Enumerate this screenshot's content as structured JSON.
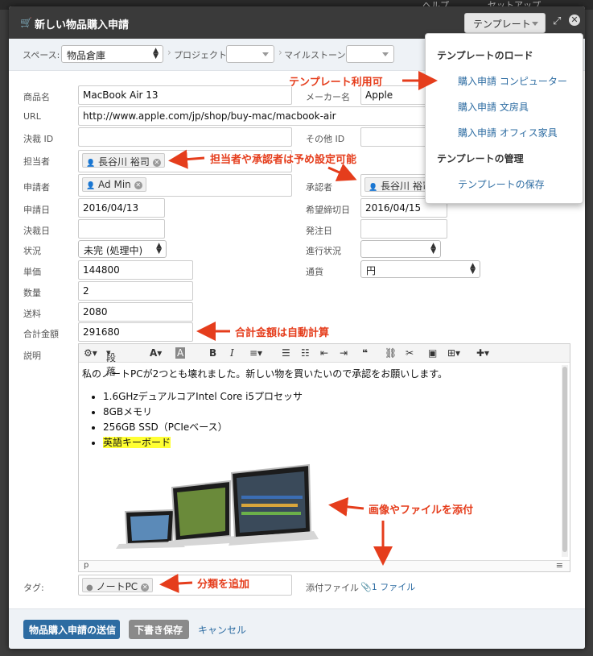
{
  "background": {
    "left_text": "ヘルプ",
    "right_text": "セットアップ"
  },
  "titlebar": {
    "title": "新しい物品購入申請",
    "template_button": "テンプレート"
  },
  "toolbar": {
    "space_label": "スペース:",
    "space_value": "物品倉庫",
    "project_label": "プロジェクト",
    "milestone_label": "マイルストーン"
  },
  "form": {
    "product_name": {
      "label": "商品名",
      "value": "MacBook Air 13"
    },
    "maker": {
      "label": "メーカー名",
      "value": "Apple"
    },
    "url": {
      "label": "URL",
      "value": "http://www.apple.com/jp/shop/buy-mac/macbook-air"
    },
    "decision_id": {
      "label": "決裁 ID",
      "value": ""
    },
    "other_id": {
      "label": "その他 ID",
      "value": ""
    },
    "assignee": {
      "label": "担当者",
      "value": "長谷川 裕司"
    },
    "applicant": {
      "label": "申請者",
      "value": "Ad Min"
    },
    "approver": {
      "label": "承認者",
      "value": "長谷川 裕司"
    },
    "apply_date": {
      "label": "申請日",
      "value": "2016/04/13"
    },
    "due_date": {
      "label": "希望締切日",
      "value": "2016/04/15"
    },
    "decision_date": {
      "label": "決裁日",
      "value": ""
    },
    "order_date": {
      "label": "発注日",
      "value": ""
    },
    "status": {
      "label": "状況",
      "value": "未完 (処理中)"
    },
    "progress": {
      "label": "進行状況",
      "value": ""
    },
    "unit_price": {
      "label": "単価",
      "value": "144800"
    },
    "currency": {
      "label": "通貨",
      "value": "円"
    },
    "quantity": {
      "label": "数量",
      "value": "2"
    },
    "shipping": {
      "label": "送料",
      "value": "2080"
    },
    "total": {
      "label": "合計金額",
      "value": "291680"
    },
    "description_label": "説明",
    "tags_label": "タグ:",
    "tag_value": "ノートPC",
    "attach_label": "添付ファイル",
    "attach_value": "1 ファイル"
  },
  "editor": {
    "paragraph_btn": "段落",
    "body_text": "私のノートPCが2つとも壊れました。新しい物を買いたいので承認をお願いします。",
    "items": [
      "1.6GHzデュアルコアIntel Core i5プロセッサ",
      "8GBメモリ",
      "256GB SSD（PCIeベース）",
      "英語キーボード"
    ],
    "status_path": "p"
  },
  "footer": {
    "submit": "物品購入申請の送信",
    "draft": "下書き保存",
    "cancel": "キャンセル"
  },
  "dropdown": {
    "load_header": "テンプレートのロード",
    "items": [
      "購入申請 コンピューター",
      "購入申請 文房具",
      "購入申請 オフィス家具"
    ],
    "manage_header": "テンプレートの管理",
    "save_item": "テンプレートの保存"
  },
  "annotations": {
    "template": "テンプレート利用可",
    "preset": "担当者や承認者は予め設定可能",
    "auto_calc": "合計金額は自動計算",
    "attach": "画像やファイルを添付",
    "tag": "分類を追加"
  },
  "colors": {
    "accent": "#2d6ca2",
    "annotation": "#e53d1c",
    "highlight": "#ffff33"
  }
}
